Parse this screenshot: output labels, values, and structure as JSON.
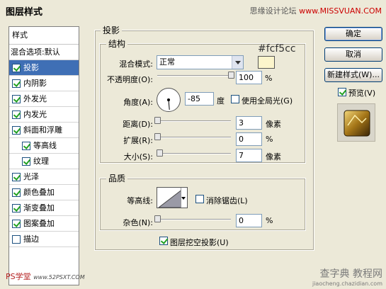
{
  "window": {
    "title": "图层样式",
    "watermark_top": "思缘设计论坛",
    "watermark_top_url": "www.MISSVUAN.COM"
  },
  "left_panel": {
    "header": "样式",
    "blend_options": "混合选项:默认",
    "items": [
      {
        "label": "投影",
        "checked": true,
        "selected": true,
        "sub": false
      },
      {
        "label": "内阴影",
        "checked": true,
        "selected": false,
        "sub": false
      },
      {
        "label": "外发光",
        "checked": true,
        "selected": false,
        "sub": false
      },
      {
        "label": "内发光",
        "checked": true,
        "selected": false,
        "sub": false
      },
      {
        "label": "斜面和浮雕",
        "checked": true,
        "selected": false,
        "sub": false
      },
      {
        "label": "等高线",
        "checked": true,
        "selected": false,
        "sub": true
      },
      {
        "label": "纹理",
        "checked": true,
        "selected": false,
        "sub": true
      },
      {
        "label": "光泽",
        "checked": true,
        "selected": false,
        "sub": false
      },
      {
        "label": "颜色叠加",
        "checked": true,
        "selected": false,
        "sub": false
      },
      {
        "label": "渐变叠加",
        "checked": true,
        "selected": false,
        "sub": false
      },
      {
        "label": "图案叠加",
        "checked": true,
        "selected": false,
        "sub": false
      },
      {
        "label": "描边",
        "checked": false,
        "selected": false,
        "sub": false
      }
    ],
    "bottom_logo_a": "PS学堂",
    "bottom_logo_b": "www.52PSXT.COM"
  },
  "shadow": {
    "title": "投影",
    "structure": {
      "title": "结构",
      "blend_mode_label": "混合模式:",
      "blend_mode_value": "正常",
      "color_hex": "#fcf5cc",
      "color": "#fcf5cc",
      "opacity_label": "不透明度(O):",
      "opacity_value": "100",
      "opacity_unit": "%",
      "opacity_level": 1.0,
      "angle_label": "角度(A):",
      "angle_value": "-85",
      "angle_unit": "度",
      "global_light_label": "使用全局光(G)",
      "global_light_checked": false,
      "distance_label": "距离(D):",
      "distance_value": "3",
      "distance_unit": "像素",
      "distance_level": 0.0,
      "spread_label": "扩展(R):",
      "spread_value": "0",
      "spread_unit": "%",
      "spread_level": 0.0,
      "size_label": "大小(S):",
      "size_value": "7",
      "size_unit": "像素",
      "size_level": 0.03
    },
    "quality": {
      "title": "品质",
      "contour_label": "等高线:",
      "antialias_label": "消除锯齿(L)",
      "antialias_checked": false,
      "noise_label": "杂色(N):",
      "noise_value": "0",
      "noise_unit": "%",
      "noise_level": 0.0
    },
    "knockout_label": "图层挖空投影(U)",
    "knockout_checked": true
  },
  "buttons": {
    "ok": "确定",
    "cancel": "取消",
    "new_style": "新建样式(W)...",
    "preview": "预览(V)",
    "preview_checked": true
  },
  "watermark_bottom": {
    "text": "查字典 教程网",
    "url": "jiaocheng.chazidian.com"
  }
}
